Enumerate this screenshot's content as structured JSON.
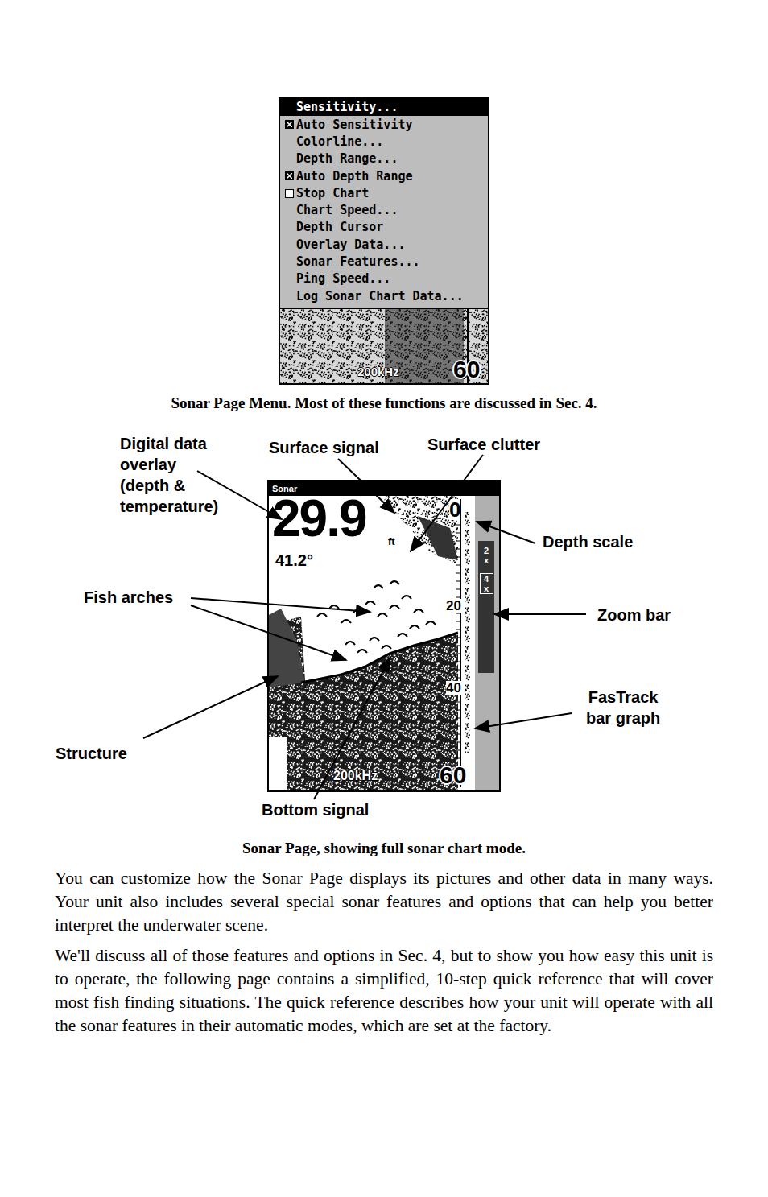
{
  "menu_screenshot": {
    "items": [
      {
        "label": "Sensitivity...",
        "kind": "action",
        "selected": true
      },
      {
        "label": "Auto Sensitivity",
        "kind": "checkbox",
        "checked": true,
        "selected": false
      },
      {
        "label": "Colorline...",
        "kind": "action",
        "selected": false
      },
      {
        "label": "Depth Range...",
        "kind": "action",
        "selected": false
      },
      {
        "label": "Auto Depth Range",
        "kind": "checkbox",
        "checked": true,
        "selected": false
      },
      {
        "label": "Stop Chart",
        "kind": "checkbox",
        "checked": false,
        "selected": false
      },
      {
        "label": "Chart Speed...",
        "kind": "action",
        "selected": false
      },
      {
        "label": "Depth Cursor",
        "kind": "action",
        "selected": false
      },
      {
        "label": "Overlay Data...",
        "kind": "action",
        "selected": false
      },
      {
        "label": "Sonar Features...",
        "kind": "action",
        "selected": false
      },
      {
        "label": "Ping Speed...",
        "kind": "action",
        "selected": false
      },
      {
        "label": "Log Sonar Chart Data...",
        "kind": "action",
        "selected": false
      }
    ],
    "frequency": "200kHz",
    "depth_max": "60"
  },
  "menu_caption": "Sonar Page Menu. Most of these functions are discussed in Sec. 4.",
  "sonar_screen": {
    "title": "Sonar",
    "depth": "29.9",
    "unit": "ft",
    "temperature": "41.2°",
    "scale": [
      "0",
      "20",
      "40"
    ],
    "depth_max": "60",
    "zoom": [
      {
        "label": "2x",
        "selected": false
      },
      {
        "label": "4x",
        "selected": true
      }
    ],
    "frequency": "200kHz"
  },
  "callouts": [
    {
      "id": "overlay",
      "lines": [
        "Digital data",
        "overlay",
        "(depth &",
        "temperature)"
      ]
    },
    {
      "id": "surface-signal",
      "lines": [
        "Surface signal"
      ]
    },
    {
      "id": "surface-clutter",
      "lines": [
        "Surface clutter"
      ]
    },
    {
      "id": "depth-scale",
      "lines": [
        "Depth scale"
      ]
    },
    {
      "id": "fish-arches",
      "lines": [
        "Fish arches"
      ]
    },
    {
      "id": "zoom-bar",
      "lines": [
        "Zoom bar"
      ]
    },
    {
      "id": "fastrack",
      "lines": [
        "FasTrack",
        "bar graph"
      ]
    },
    {
      "id": "structure",
      "lines": [
        "Structure"
      ]
    },
    {
      "id": "bottom-signal",
      "lines": [
        "Bottom signal"
      ]
    }
  ],
  "diagram_caption": "Sonar Page, showing full sonar chart mode.",
  "paragraphs": [
    "You can customize how the Sonar Page displays its pictures and other data in many ways. Your unit also includes several special sonar features and options that can help you better interpret the underwater scene.",
    "We'll discuss all of those features and options in Sec. 4, but to show you how easy this unit is to operate, the following page contains a simplified, 10-step quick reference that will cover most fish finding situations. The quick reference describes how your unit will operate with all the sonar features in their automatic modes, which are set at the factory."
  ]
}
